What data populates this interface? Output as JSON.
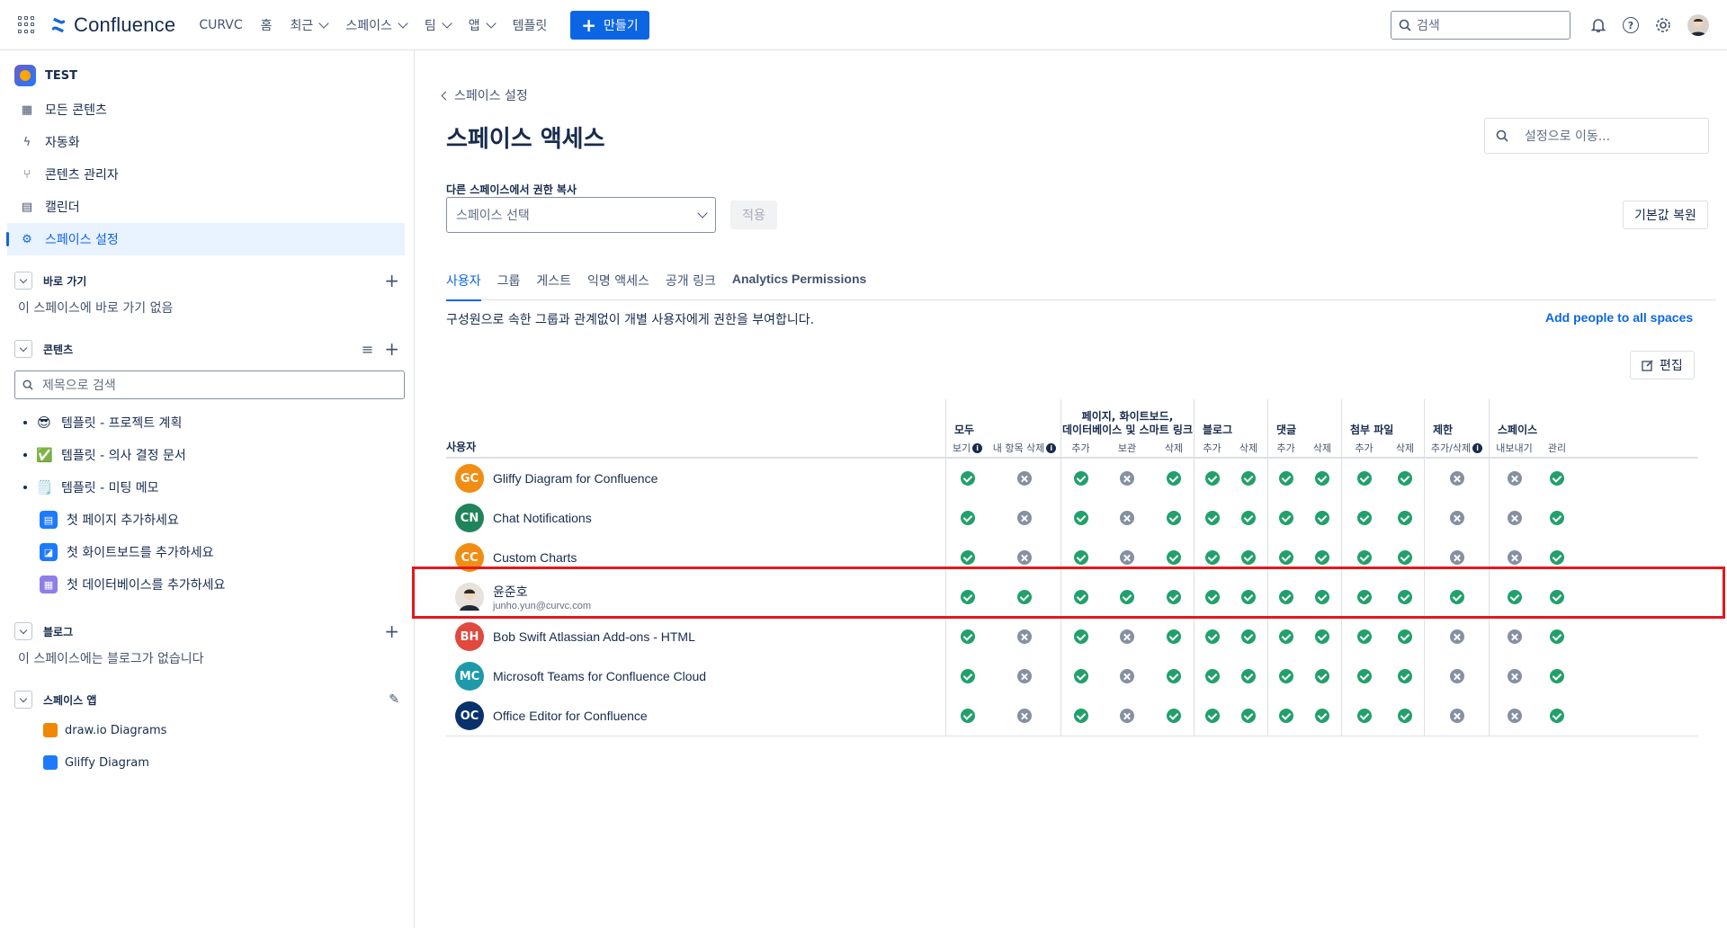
{
  "topnav": {
    "product": "Confluence",
    "items": [
      {
        "label": "CURVC",
        "dropdown": false
      },
      {
        "label": "홈",
        "dropdown": false
      },
      {
        "label": "최근",
        "dropdown": true
      },
      {
        "label": "스페이스",
        "dropdown": true
      },
      {
        "label": "팀",
        "dropdown": true
      },
      {
        "label": "앱",
        "dropdown": true
      },
      {
        "label": "템플릿",
        "dropdown": false
      }
    ],
    "create_label": "만들기",
    "search_placeholder": "검색",
    "accent": "#0c66e4"
  },
  "sidebar": {
    "space_name": "TEST",
    "items": [
      {
        "label": "모든 콘텐츠",
        "icon": "grid-icon"
      },
      {
        "label": "자동화",
        "icon": "lightning-icon"
      },
      {
        "label": "콘텐츠 관리자",
        "icon": "content-manager-icon"
      },
      {
        "label": "캘린더",
        "icon": "calendar-icon"
      },
      {
        "label": "스페이스 설정",
        "icon": "gear-icon",
        "active": true
      }
    ],
    "shortcuts": {
      "title": "바로 가기",
      "empty": "이 스페이스에 바로 가기 없음"
    },
    "content": {
      "title": "콘텐츠",
      "search_placeholder": "제목으로 검색",
      "tree": [
        {
          "label": "템플릿 - 프로젝트 계획",
          "emoji": "😎"
        },
        {
          "label": "템플릿 - 의사 결정 문서",
          "emoji": "✅"
        },
        {
          "label": "템플릿 - 미팅 메모",
          "emoji": "🗒️"
        }
      ],
      "add_items": [
        {
          "label": "첫 페이지 추가하세요",
          "icon": "page-icon",
          "color": "#1d7afc"
        },
        {
          "label": "첫 화이트보드를 추가하세요",
          "icon": "whiteboard-icon",
          "color": "#1d7afc"
        },
        {
          "label": "첫 데이터베이스를 추가하세요",
          "icon": "database-icon",
          "color": "#8f7ee7"
        }
      ]
    },
    "blog": {
      "title": "블로그",
      "empty": "이 스페이스에는 블로그가 없습니다"
    },
    "apps": {
      "title": "스페이스 앱",
      "items": [
        {
          "label": "draw.io Diagrams",
          "color": "#f08705"
        },
        {
          "label": "Gliffy Diagram",
          "color": "#1d7afc"
        }
      ]
    }
  },
  "main": {
    "back_label": "스페이스 설정",
    "title": "스페이스 액세스",
    "goto_placeholder": "설정으로 이동...",
    "copy_label": "다른 스페이스에서 권한 복사",
    "space_select_placeholder": "스페이스 선택",
    "apply_label": "적용",
    "reset_label": "기본값 복원",
    "tabs": [
      "사용자",
      "그룹",
      "게스트",
      "익명 액세스",
      "공개 링크",
      "Analytics Permissions"
    ],
    "active_tab": 0,
    "description": "구성원으로 속한 그룹과 관계없이 개별 사용자에게 권한을 부여합니다.",
    "add_all_label": "Add people to all spaces",
    "edit_label": "편집"
  },
  "table": {
    "user_header": "사용자",
    "groups": [
      {
        "label": "모두",
        "cols": [
          "보기",
          "내 항목 삭제"
        ],
        "info": [
          true,
          true
        ]
      },
      {
        "label": "페이지, 화이트보드,\n데이터베이스 및 스마트 링크",
        "cols": [
          "추가",
          "보관",
          "삭제"
        ]
      },
      {
        "label": "블로그",
        "cols": [
          "추가",
          "삭제"
        ]
      },
      {
        "label": "댓글",
        "cols": [
          "추가",
          "삭제"
        ]
      },
      {
        "label": "첨부 파일",
        "cols": [
          "추가",
          "삭제"
        ]
      },
      {
        "label": "제한",
        "cols": [
          "추가/삭제"
        ],
        "info": [
          true
        ]
      },
      {
        "label": "스페이스",
        "cols": [
          "내보내기",
          "관리"
        ]
      }
    ],
    "rows": [
      {
        "initials": "GC",
        "name": "Gliffy Diagram for Confluence",
        "email": "",
        "color": "#f18d13",
        "perms": [
          1,
          0,
          1,
          0,
          1,
          1,
          1,
          1,
          1,
          1,
          1,
          0,
          0,
          1
        ]
      },
      {
        "initials": "CN",
        "name": "Chat Notifications",
        "email": "",
        "color": "#1f845a",
        "perms": [
          1,
          0,
          1,
          0,
          1,
          1,
          1,
          1,
          1,
          1,
          1,
          0,
          0,
          1
        ]
      },
      {
        "initials": "CC",
        "name": "Custom Charts",
        "email": "",
        "color": "#f18d13",
        "perms": [
          1,
          0,
          1,
          0,
          1,
          1,
          1,
          1,
          1,
          1,
          1,
          0,
          0,
          1
        ]
      },
      {
        "initials": "",
        "name": "윤준호",
        "email": "junho.yun@curvc.com",
        "color": "#e8e2dc",
        "photo": true,
        "perms": [
          1,
          1,
          1,
          1,
          1,
          1,
          1,
          1,
          1,
          1,
          1,
          1,
          1,
          1
        ]
      },
      {
        "initials": "BH",
        "name": "Bob Swift Atlassian Add-ons - HTML",
        "email": "",
        "color": "#e2483d",
        "perms": [
          1,
          0,
          1,
          0,
          1,
          1,
          1,
          1,
          1,
          1,
          1,
          0,
          0,
          1
        ]
      },
      {
        "initials": "MC",
        "name": "Microsoft Teams for Confluence Cloud",
        "email": "",
        "color": "#1d9aaa",
        "perms": [
          1,
          0,
          1,
          0,
          1,
          1,
          1,
          1,
          1,
          1,
          1,
          0,
          0,
          1
        ]
      },
      {
        "initials": "OC",
        "name": "Office Editor for Confluence",
        "email": "",
        "color": "#09326c",
        "perms": [
          1,
          0,
          1,
          0,
          1,
          1,
          1,
          1,
          1,
          1,
          1,
          0,
          0,
          1
        ]
      }
    ],
    "highlighted_row": 3,
    "highlight_color": "#e2181c"
  }
}
